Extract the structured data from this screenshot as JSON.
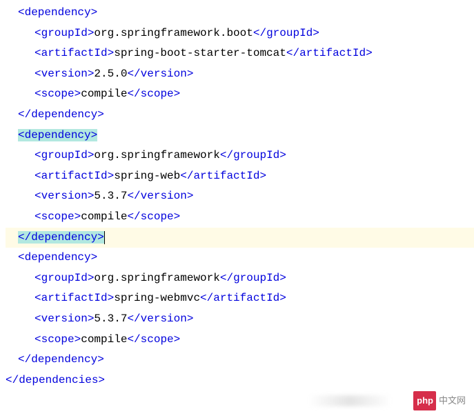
{
  "lines": [
    {
      "indent": 1,
      "segments": [
        {
          "type": "tag",
          "t": "<dependency>"
        }
      ],
      "highlight": false,
      "lineHighlight": false
    },
    {
      "indent": 2,
      "segments": [
        {
          "type": "tag",
          "t": "<groupId>"
        },
        {
          "type": "text",
          "t": "org.springframework.boot"
        },
        {
          "type": "tag",
          "t": "</groupId>"
        }
      ],
      "highlight": false,
      "lineHighlight": false
    },
    {
      "indent": 2,
      "segments": [
        {
          "type": "tag",
          "t": "<artifactId>"
        },
        {
          "type": "text",
          "t": "spring-boot-starter-tomcat"
        },
        {
          "type": "tag",
          "t": "</artifactId>"
        }
      ],
      "highlight": false,
      "lineHighlight": false
    },
    {
      "indent": 2,
      "segments": [
        {
          "type": "tag",
          "t": "<version>"
        },
        {
          "type": "text",
          "t": "2.5.0"
        },
        {
          "type": "tag",
          "t": "</version>"
        }
      ],
      "highlight": false,
      "lineHighlight": false
    },
    {
      "indent": 2,
      "segments": [
        {
          "type": "tag",
          "t": "<scope>"
        },
        {
          "type": "text",
          "t": "compile"
        },
        {
          "type": "tag",
          "t": "</scope>"
        }
      ],
      "highlight": false,
      "lineHighlight": false
    },
    {
      "indent": 1,
      "segments": [
        {
          "type": "tag",
          "t": "</dependency>"
        }
      ],
      "highlight": false,
      "lineHighlight": false
    },
    {
      "indent": 1,
      "segments": [
        {
          "type": "tag",
          "t": "<dependency>"
        }
      ],
      "highlight": true,
      "lineHighlight": false
    },
    {
      "indent": 2,
      "segments": [
        {
          "type": "tag",
          "t": "<groupId>"
        },
        {
          "type": "text",
          "t": "org.springframework"
        },
        {
          "type": "tag",
          "t": "</groupId>"
        }
      ],
      "highlight": false,
      "lineHighlight": false
    },
    {
      "indent": 2,
      "segments": [
        {
          "type": "tag",
          "t": "<artifactId>"
        },
        {
          "type": "text",
          "t": "spring-web"
        },
        {
          "type": "tag",
          "t": "</artifactId>"
        }
      ],
      "highlight": false,
      "lineHighlight": false
    },
    {
      "indent": 2,
      "segments": [
        {
          "type": "tag",
          "t": "<version>"
        },
        {
          "type": "text",
          "t": "5.3.7"
        },
        {
          "type": "tag",
          "t": "</version>"
        }
      ],
      "highlight": false,
      "lineHighlight": false
    },
    {
      "indent": 2,
      "segments": [
        {
          "type": "tag",
          "t": "<scope>"
        },
        {
          "type": "text",
          "t": "compile"
        },
        {
          "type": "tag",
          "t": "</scope>"
        }
      ],
      "highlight": false,
      "lineHighlight": false
    },
    {
      "indent": 1,
      "segments": [
        {
          "type": "tag",
          "t": "</dependency>"
        }
      ],
      "highlight": true,
      "lineHighlight": true,
      "cursor": true
    },
    {
      "indent": 1,
      "segments": [
        {
          "type": "tag",
          "t": "<dependency>"
        }
      ],
      "highlight": false,
      "lineHighlight": false
    },
    {
      "indent": 2,
      "segments": [
        {
          "type": "tag",
          "t": "<groupId>"
        },
        {
          "type": "text",
          "t": "org.springframework"
        },
        {
          "type": "tag",
          "t": "</groupId>"
        }
      ],
      "highlight": false,
      "lineHighlight": false
    },
    {
      "indent": 2,
      "segments": [
        {
          "type": "tag",
          "t": "<artifactId>"
        },
        {
          "type": "text",
          "t": "spring-webmvc"
        },
        {
          "type": "tag",
          "t": "</artifactId>"
        }
      ],
      "highlight": false,
      "lineHighlight": false
    },
    {
      "indent": 2,
      "segments": [
        {
          "type": "tag",
          "t": "<version>"
        },
        {
          "type": "text",
          "t": "5.3.7"
        },
        {
          "type": "tag",
          "t": "</version>"
        }
      ],
      "highlight": false,
      "lineHighlight": false
    },
    {
      "indent": 2,
      "segments": [
        {
          "type": "tag",
          "t": "<scope>"
        },
        {
          "type": "text",
          "t": "compile"
        },
        {
          "type": "tag",
          "t": "</scope>"
        }
      ],
      "highlight": false,
      "lineHighlight": false
    },
    {
      "indent": 1,
      "segments": [
        {
          "type": "tag",
          "t": "</dependency>"
        }
      ],
      "highlight": false,
      "lineHighlight": false
    },
    {
      "indent": 0,
      "segments": [
        {
          "type": "tag",
          "t": "</dependencies>"
        }
      ],
      "highlight": false,
      "lineHighlight": false
    }
  ],
  "watermark": {
    "logo": "php",
    "text": "中文网"
  }
}
